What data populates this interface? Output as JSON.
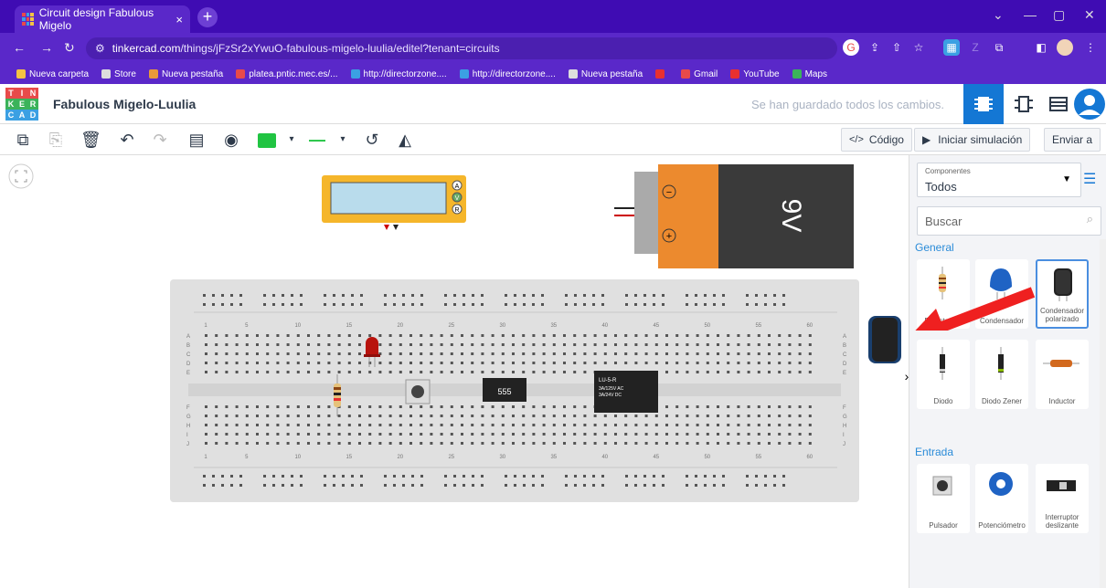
{
  "browser": {
    "tab_title": "Circuit design Fabulous Migelo",
    "tab_close": "×",
    "new_tab": "+",
    "url_domain": "tinkercad.com",
    "url_path": "/things/jFzSr2xYwuO-fabulous-migelo-luulia/editel?tenant=circuits",
    "bookmarks": [
      {
        "label": "Nueva carpeta",
        "color": "#f5c343"
      },
      {
        "label": "Store",
        "color": "#dddddd"
      },
      {
        "label": "Nueva pestaña",
        "color": "#e89a3a"
      },
      {
        "label": "platea.pntic.mec.es/...",
        "color": "#e84a4a"
      },
      {
        "label": "http://directorzone....",
        "color": "#3ba0e3"
      },
      {
        "label": "http://directorzone....",
        "color": "#3ba0e3"
      },
      {
        "label": "Nueva pestaña",
        "color": "#dddddd"
      },
      {
        "label": "",
        "color": "#e83030"
      },
      {
        "label": "Gmail",
        "color": "#e84a4a"
      },
      {
        "label": "YouTube",
        "color": "#e83030"
      },
      {
        "label": "Maps",
        "color": "#3bb35a"
      }
    ]
  },
  "app": {
    "logo_letters": [
      "T",
      "I",
      "N",
      "K",
      "E",
      "R",
      "C",
      "A",
      "D"
    ],
    "project_name": "Fabulous Migelo-Luulia",
    "saved_status": "Se han guardado todos los cambios."
  },
  "toolbar": {
    "code_label": "Código",
    "sim_label": "Iniciar simulación",
    "send_label": "Enviar a"
  },
  "canvas": {
    "battery_label": "9V",
    "chip_label": "555",
    "relay_label": "LU-5-R",
    "relay_sub1": "3A/125V AC",
    "relay_sub2": "3A/24V DC",
    "multimeter_buttons": [
      "A",
      "V",
      "R"
    ],
    "row_letters_top": [
      "A",
      "B",
      "C",
      "D",
      "E"
    ],
    "row_letters_bottom": [
      "F",
      "G",
      "H",
      "I",
      "J"
    ],
    "col_numbers": [
      "1",
      "5",
      "10",
      "15",
      "20",
      "25",
      "30",
      "35",
      "40",
      "45",
      "50",
      "55",
      "60"
    ]
  },
  "panel": {
    "select_small": "Componentes",
    "select_value": "Todos",
    "search_placeholder": "Buscar",
    "section_general": "General",
    "section_input": "Entrada",
    "general": [
      "Resistencia",
      "Condensador",
      "Condensador polarizado",
      "Diodo",
      "Diodo Zener",
      "Inductor"
    ],
    "input": [
      "Pulsador",
      "Potenciómetro",
      "Interruptor deslizante"
    ]
  }
}
